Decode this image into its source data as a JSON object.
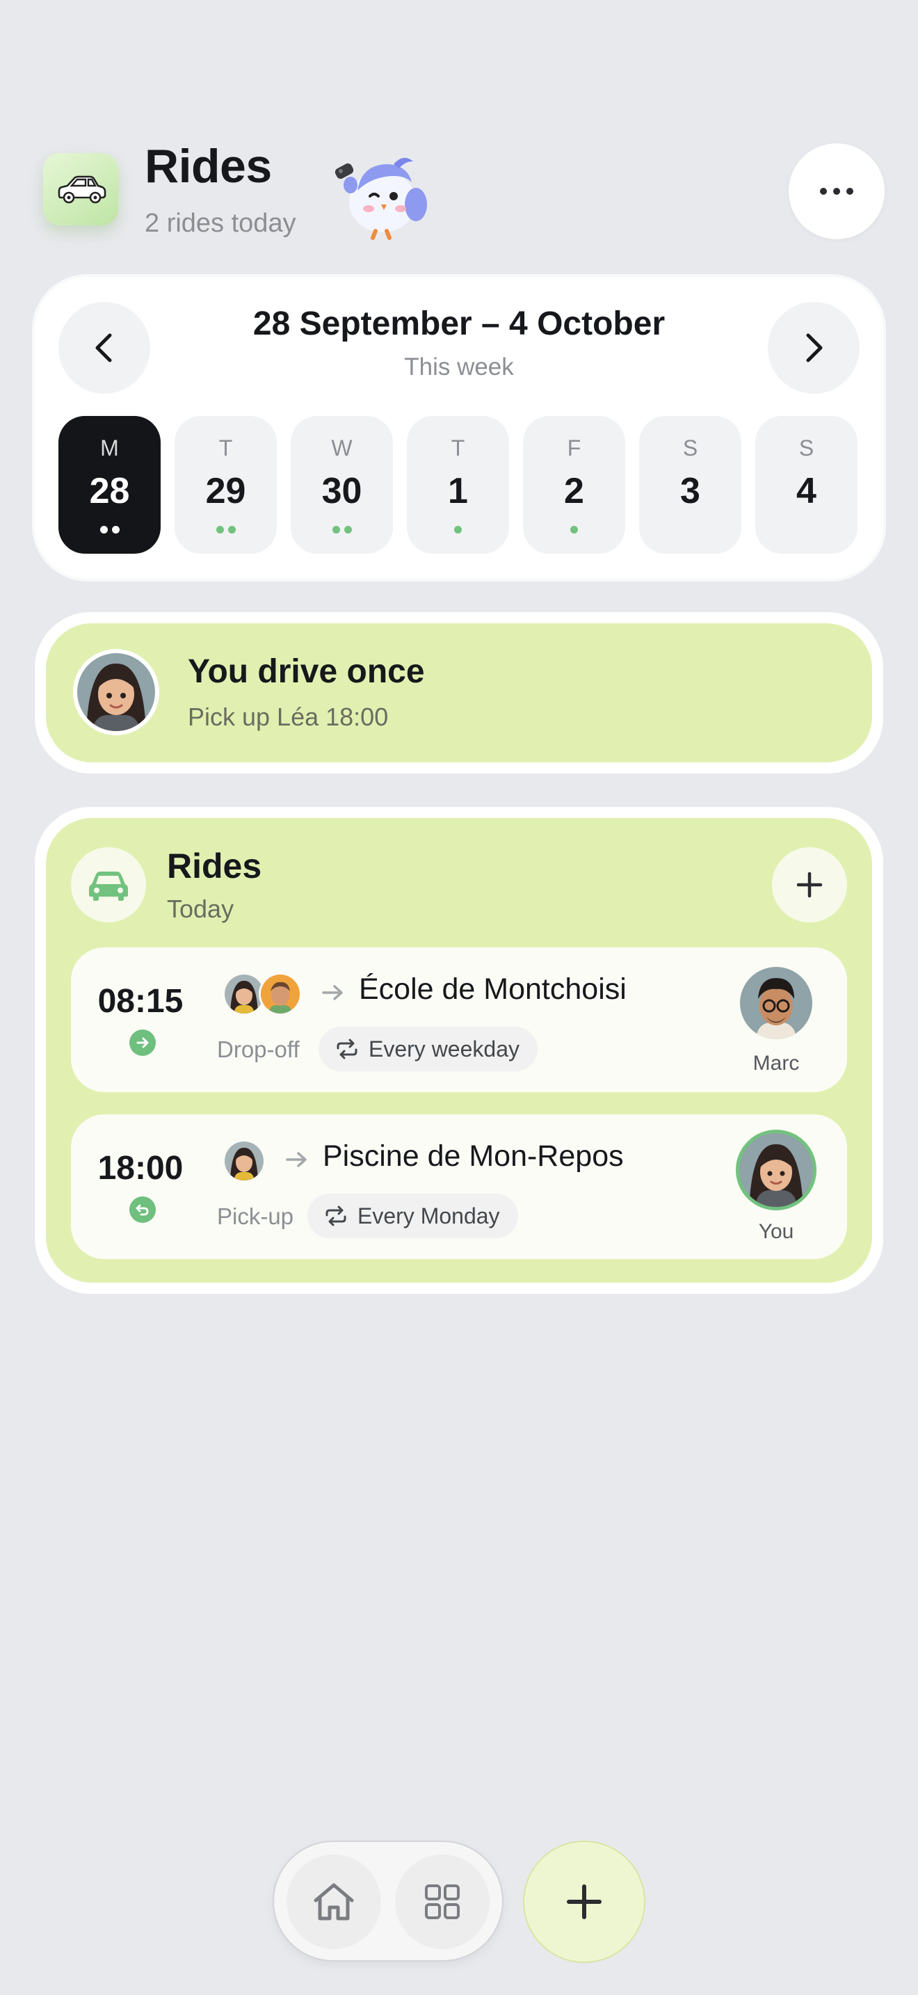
{
  "header": {
    "title": "Rides",
    "subtitle": "2 rides today",
    "app_icon": "car-icon",
    "mascot": "bird-mascot",
    "more_icon": "more-horizontal-icon"
  },
  "calendar": {
    "range": "28 September – 4 October",
    "label": "This week",
    "prev_icon": "chevron-left-icon",
    "next_icon": "chevron-right-icon",
    "days": [
      {
        "letter": "M",
        "num": "28",
        "dots": 2,
        "selected": true
      },
      {
        "letter": "T",
        "num": "29",
        "dots": 2,
        "selected": false
      },
      {
        "letter": "W",
        "num": "30",
        "dots": 2,
        "selected": false
      },
      {
        "letter": "T",
        "num": "1",
        "dots": 1,
        "selected": false
      },
      {
        "letter": "F",
        "num": "2",
        "dots": 1,
        "selected": false
      },
      {
        "letter": "S",
        "num": "3",
        "dots": 0,
        "selected": false
      },
      {
        "letter": "S",
        "num": "4",
        "dots": 0,
        "selected": false
      }
    ]
  },
  "drive_banner": {
    "title": "You drive once",
    "subtitle": "Pick up Léa 18:00"
  },
  "rides": {
    "title": "Rides",
    "subtitle": "Today",
    "items": [
      {
        "time": "08:15",
        "destination": "École de Montchoisi",
        "type": "Drop-off",
        "frequency": "Every weekday",
        "driver": "Marc"
      },
      {
        "time": "18:00",
        "destination": "Piscine de Mon-Repos",
        "type": "Pick-up",
        "frequency": "Every Monday",
        "driver": "You"
      }
    ]
  },
  "tabbar": {
    "home_icon": "home-icon",
    "grid_icon": "grid-icon",
    "add_icon": "plus-icon"
  },
  "colors": {
    "background": "#e8e9ed",
    "accent_green": "#e1f0b1",
    "dot_green": "#72c27f",
    "selected_day": "#141518"
  }
}
